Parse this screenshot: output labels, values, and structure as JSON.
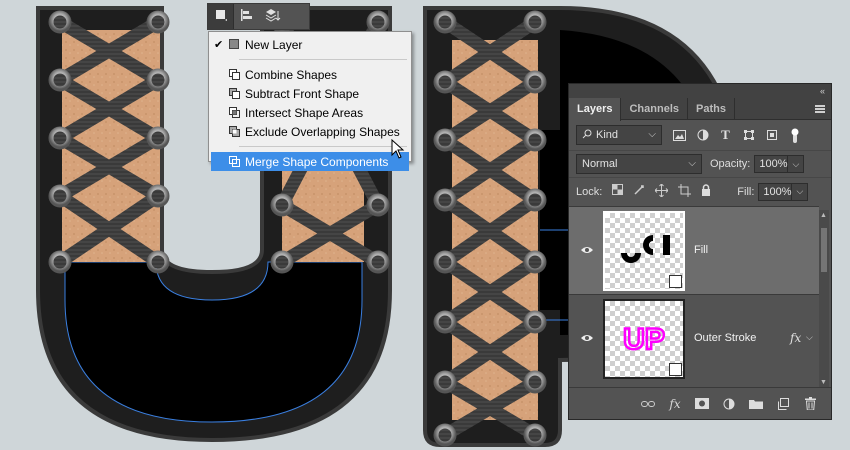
{
  "options_bar": {
    "buttons": [
      "path-operations-icon",
      "path-alignment-icon",
      "path-arrangement-icon"
    ]
  },
  "menu": {
    "items": [
      {
        "label": "New Layer",
        "checked": true,
        "icon": "new-layer-icon"
      },
      {
        "label": "Combine Shapes",
        "checked": false,
        "icon": "combine-shapes-icon"
      },
      {
        "label": "Subtract Front Shape",
        "checked": false,
        "icon": "subtract-front-shape-icon"
      },
      {
        "label": "Intersect Shape Areas",
        "checked": false,
        "icon": "intersect-shape-areas-icon"
      },
      {
        "label": "Exclude Overlapping Shapes",
        "checked": false,
        "icon": "exclude-overlapping-shapes-icon"
      }
    ],
    "highlighted": {
      "label": "Merge Shape Components",
      "icon": "merge-shape-components-icon"
    }
  },
  "layers_panel": {
    "collapse": "«",
    "tabs": [
      "Layers",
      "Channels",
      "Paths"
    ],
    "active_tab": "Layers",
    "filter": {
      "kind_label": "Kind",
      "icons": [
        "pixel-filter-icon",
        "adjustment-filter-icon",
        "type-filter-icon",
        "shape-filter-icon",
        "smart-object-filter-icon",
        "filter-toggle-icon"
      ]
    },
    "blend_mode": "Normal",
    "opacity_label": "Opacity:",
    "opacity_value": "100%",
    "lock_label": "Lock:",
    "fill_label": "Fill:",
    "fill_value": "100%",
    "layers": [
      {
        "name": "Fill",
        "selected": true,
        "has_fx": false
      },
      {
        "name": "Outer Stroke",
        "selected": false,
        "has_fx": true,
        "fx_label": "fx",
        "thumb_text": "UP"
      }
    ],
    "bottom_icons": [
      "link-layers-icon",
      "fx-icon",
      "layer-mask-icon",
      "adjustment-layer-icon",
      "group-folder-icon",
      "new-layer-icon",
      "trash-icon"
    ],
    "fx_label": "fx"
  },
  "colors": {
    "menu_highlight": "#3d8ee8",
    "panel_bg": "#535353",
    "selected_layer": "#6d6d6d",
    "leather": "#d9a57a",
    "outline_blue": "#3a7fe0",
    "thumb_stroke": "#ff00ff"
  }
}
